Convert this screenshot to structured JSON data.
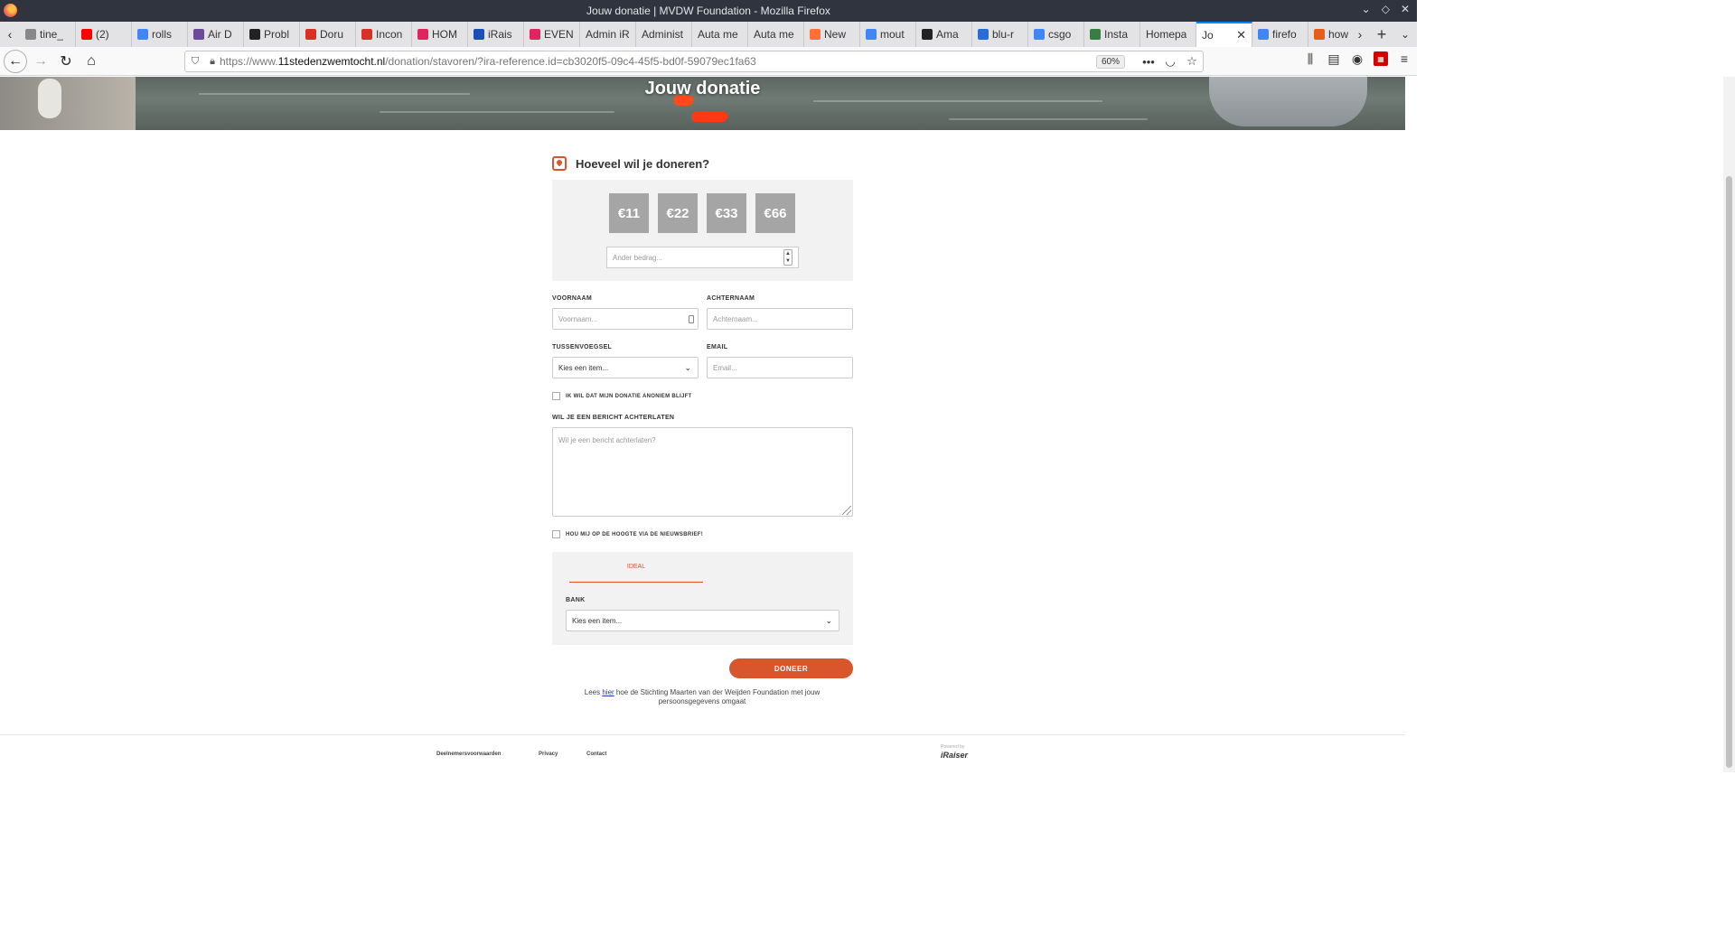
{
  "window": {
    "title": "Jouw donatie | MVDW Foundation - Mozilla Firefox"
  },
  "tabs": [
    {
      "title": "tine_",
      "icon": "tab-icon",
      "color": "#888888"
    },
    {
      "title": "(2)",
      "icon": "youtube-icon",
      "color": "#ff0000"
    },
    {
      "title": "rolls",
      "icon": "google-icon",
      "color": "#4285f4"
    },
    {
      "title": "Air D",
      "icon": "airbus-icon",
      "color": "#6b4c9a"
    },
    {
      "title": "Probl",
      "icon": "warning-icon",
      "color": "#222222"
    },
    {
      "title": "Doru",
      "icon": "gmail-icon",
      "color": "#d93025"
    },
    {
      "title": "Incon",
      "icon": "gmail-icon",
      "color": "#d93025"
    },
    {
      "title": "HOM",
      "icon": "iraiser-icon",
      "color": "#e0245e"
    },
    {
      "title": "iRais",
      "icon": "iraiser10-icon",
      "color": "#1a4fb5"
    },
    {
      "title": "EVEN",
      "icon": "iraiser-icon",
      "color": "#e0245e"
    },
    {
      "title": "Admin iR",
      "icon": "",
      "color": ""
    },
    {
      "title": "Administ",
      "icon": "",
      "color": ""
    },
    {
      "title": "Auta me",
      "icon": "",
      "color": ""
    },
    {
      "title": "Auta me",
      "icon": "",
      "color": ""
    },
    {
      "title": "New",
      "icon": "firefox-icon",
      "color": "#ff7139"
    },
    {
      "title": "mout",
      "icon": "google-icon",
      "color": "#4285f4"
    },
    {
      "title": "Ama",
      "icon": "amazon-icon",
      "color": "#222222"
    },
    {
      "title": "blu-r",
      "icon": "bing-icon",
      "color": "#2b6cd4"
    },
    {
      "title": "csgo",
      "icon": "google-icon",
      "color": "#4285f4"
    },
    {
      "title": "Insta",
      "icon": "instagram-icon",
      "color": "#3a7d44"
    },
    {
      "title": "Homepa",
      "icon": "",
      "color": ""
    },
    {
      "title": "Jo",
      "icon": "",
      "color": "",
      "active": true
    },
    {
      "title": "firefo",
      "icon": "google-icon",
      "color": "#4285f4"
    },
    {
      "title": "how",
      "icon": "ask-icon",
      "color": "#e85d1a"
    }
  ],
  "navbar": {
    "url_prefix": "https://www.",
    "url_domain": "11stedenzwemtocht.nl",
    "url_path": "/donation/stavoren/?ira-reference.id=cb3020f5-09c4-45f5-bd0f-59079ec1fa63",
    "zoom": "60%"
  },
  "hero": {
    "title": "Jouw donatie"
  },
  "donation": {
    "heading": "Hoeveel wil je doneren?",
    "amounts": [
      "€11",
      "€22",
      "€33",
      "€66"
    ],
    "other_placeholder": "Ander bedrag..."
  },
  "form": {
    "firstname_label": "VOORNAAM",
    "firstname_placeholder": "Voornaam...",
    "lastname_label": "ACHTERNAAM",
    "lastname_placeholder": "Achternaam...",
    "infix_label": "TUSSENVOEGSEL",
    "infix_value": "Kies een item...",
    "email_label": "EMAIL",
    "email_placeholder": "Email...",
    "anonymous_label": "IK WIL DAT MIJN DONATIE ANONIEM BLIJFT",
    "message_label": "WIL JE EEN BERICHT ACHTERLATEN",
    "message_placeholder": "Wil je een bericht achterlaten?",
    "newsletter_label": "HOU MIJ OP DE HOOGTE VIA DE NIEUWSBRIEF!"
  },
  "payment": {
    "tab_label": "IDEAL",
    "bank_label": "BANK",
    "bank_value": "Kies een item..."
  },
  "donate_button": "DONEER",
  "privacy": {
    "before": "Lees ",
    "link": "hier",
    "after": " hoe de Stichting Maarten van der Weijden Foundation met jouw persoonsgegevens omgaat"
  },
  "footer": {
    "links": [
      "Deelnemersvoorwaarden",
      "Privacy",
      "Contact"
    ],
    "powered_by": "Powered by",
    "brand": "iRaiser"
  },
  "colors": {
    "accent": "#d9552c",
    "amount_button": "#a5a5a5",
    "panel": "#f2f2f2"
  }
}
